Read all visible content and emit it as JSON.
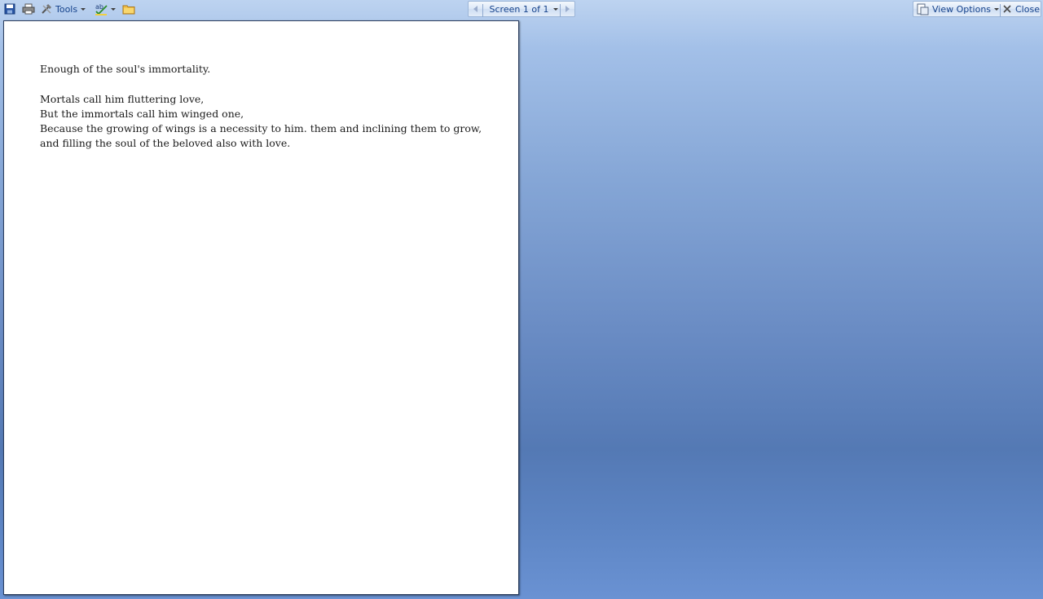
{
  "toolbar": {
    "save_icon": "save-icon",
    "print_icon": "print-icon",
    "tools_label": "Tools",
    "spelling_icon": "spelling-icon",
    "folder_icon": "folder-icon",
    "screen_label": "Screen 1 of 1",
    "view_options_label": "View Options",
    "close_label": "Close"
  },
  "document": {
    "line1": "Enough of the soul's immortality.",
    "line2": "Mortals call him fluttering love,",
    "line3": "But the immortals call him winged one,",
    "line4": "Because the growing of wings is a necessity to him. them and inclining them to grow, and filling the soul of the beloved also with love."
  },
  "colors": {
    "toolbar_text": "#15428b",
    "background_top": "#bdd3f0",
    "background_bottom": "#6a92d3",
    "page": "#ffffff"
  }
}
